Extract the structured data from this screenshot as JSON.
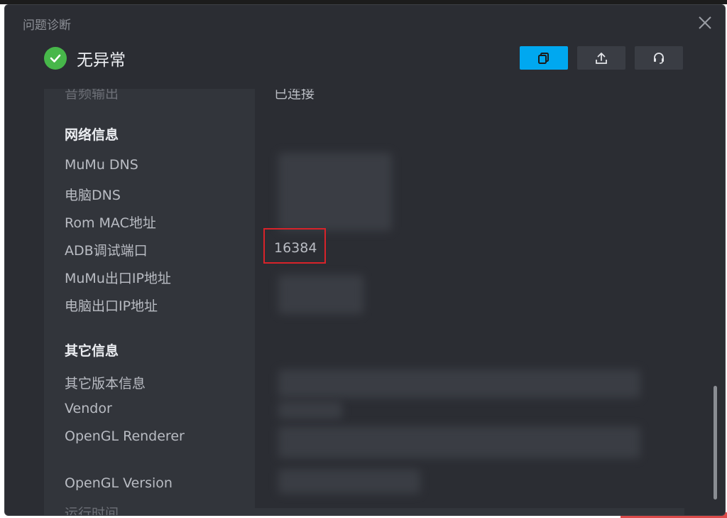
{
  "dialog": {
    "title": "问题诊断",
    "status_text": "无异常"
  },
  "colors": {
    "accent": "#00a8f0",
    "success": "#47b74a",
    "highlight": "#d8232a"
  },
  "toolbar": {
    "copy_icon": "copy-icon",
    "upload_icon": "upload-icon",
    "support_icon": "headset-icon"
  },
  "rows": {
    "partial_label": "音频输出",
    "partial_value": "已连接",
    "network_section": "网络信息",
    "mumu_dns": "MuMu DNS",
    "pc_dns": "电脑DNS",
    "rom_mac": "Rom MAC地址",
    "adb_port": "ADB调试端口",
    "adb_port_value": "16384",
    "mumu_ip": "MuMu出口IP地址",
    "pc_ip": "电脑出口IP地址",
    "other_section": "其它信息",
    "other_version": "其它版本信息",
    "vendor": "Vendor",
    "gl_renderer": "OpenGL Renderer",
    "gl_version": "OpenGL Version",
    "run_time": "运行时间"
  }
}
